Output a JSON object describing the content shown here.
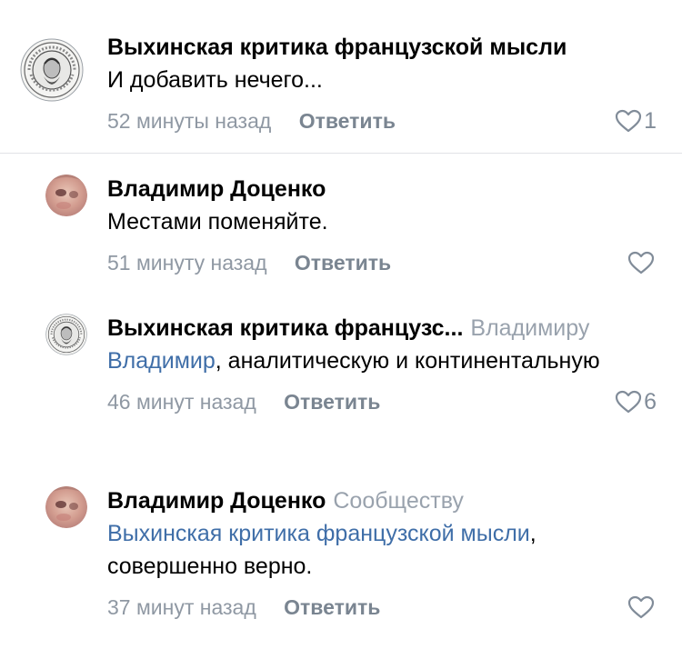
{
  "comments": [
    {
      "author": "Выхинская критика французской мысли",
      "reply_to": "",
      "mention": "",
      "text": "И добавить нечего...",
      "time": "52 минуты назад",
      "reply_label": "Ответить",
      "likes": "1",
      "avatar": "community-seal-avatar"
    },
    {
      "author": "Владимир Доценко",
      "reply_to": "",
      "mention": "",
      "text": "Местами поменяйте.",
      "time": "51 минуту назад",
      "reply_label": "Ответить",
      "likes": "",
      "avatar": "user-photo-avatar"
    },
    {
      "author": "Выхинская критика французс...",
      "reply_to": "Владимиру",
      "mention": "Владимир",
      "text": ", аналитическую и континентальную",
      "time": "46 минут назад",
      "reply_label": "Ответить",
      "likes": "6",
      "avatar": "community-seal-avatar"
    },
    {
      "author": "Владимир Доценко",
      "reply_to": "Сообществу",
      "mention": "Выхинская критика французской мысли",
      "text": ", совершенно верно.",
      "time": "37 минут назад",
      "reply_label": "Ответить",
      "likes": "",
      "avatar": "user-photo-avatar"
    }
  ],
  "colors": {
    "mention": "#3f6ea8",
    "meta": "#8f98a3",
    "icon": "#818c99"
  }
}
